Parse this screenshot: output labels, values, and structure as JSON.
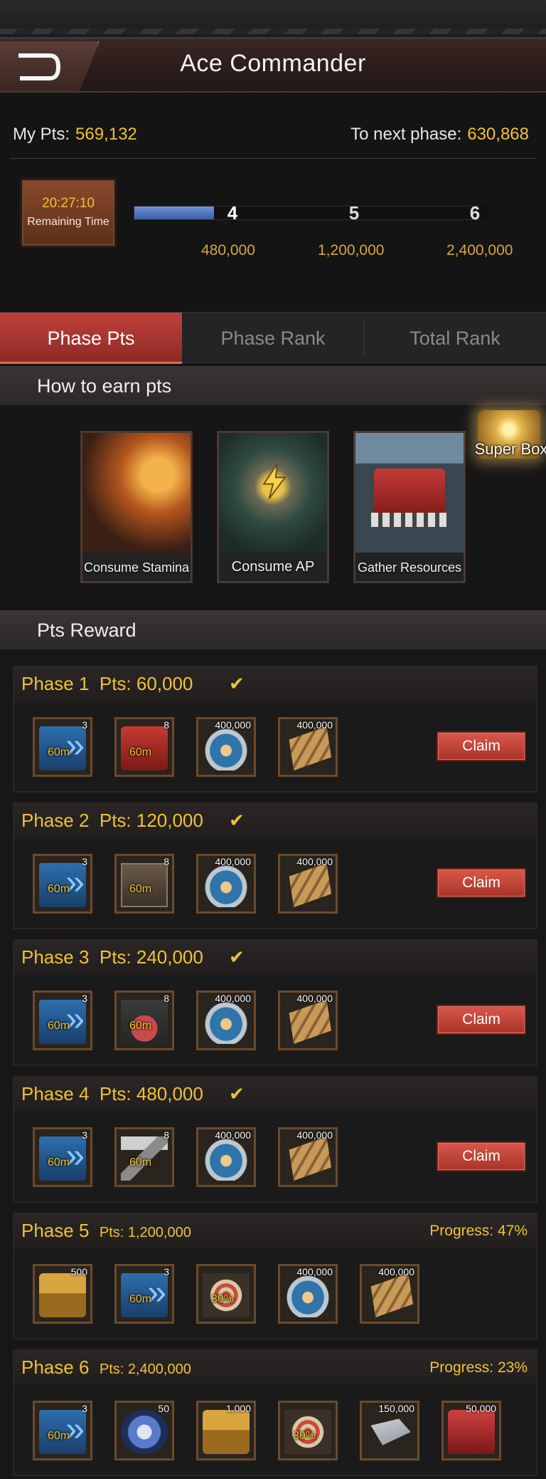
{
  "header": {
    "title": "Ace Commander"
  },
  "stats": {
    "my_pts_label": "My Pts:",
    "my_pts_value": "569,132",
    "next_phase_label": "To next phase:",
    "next_phase_value": "630,868"
  },
  "timer": {
    "time": "20:27:10",
    "label": "Remaining Time"
  },
  "phase_track": {
    "progress_fraction": 0.23,
    "nodes": [
      {
        "num": "4",
        "value": "480,000"
      },
      {
        "num": "5",
        "value": "1,200,000"
      },
      {
        "num": "6",
        "value": "2,400,000"
      }
    ]
  },
  "tabs": [
    "Phase Pts",
    "Phase Rank",
    "Total Rank"
  ],
  "earn": {
    "heading": "How to earn pts",
    "cards": [
      "Consume Stamina",
      "Consume AP",
      "Gather Resources"
    ],
    "super_box": "Super Box"
  },
  "rewards": {
    "heading": "Pts Reward",
    "claim_label": "Claim",
    "phases": [
      {
        "phase": "Phase 1",
        "pts": "Pts: 60,000",
        "checked": "✔",
        "items": [
          {
            "icon": "speedup-icon",
            "qty": "3",
            "tag": "60m"
          },
          {
            "icon": "toolbox-speedup-icon",
            "qty": "8",
            "tag": "60m"
          },
          {
            "icon": "food-can-icon",
            "qty": "400,000",
            "tag": ""
          },
          {
            "icon": "wood-icon",
            "qty": "400,000",
            "tag": ""
          }
        ]
      },
      {
        "phase": "Phase 2",
        "pts": "Pts: 120,000",
        "checked": "✔",
        "items": [
          {
            "icon": "speedup-icon",
            "qty": "3",
            "tag": "60m"
          },
          {
            "icon": "book-speedup-icon",
            "qty": "8",
            "tag": "60m"
          },
          {
            "icon": "food-can-icon",
            "qty": "400,000",
            "tag": ""
          },
          {
            "icon": "wood-icon",
            "qty": "400,000",
            "tag": ""
          }
        ]
      },
      {
        "phase": "Phase 3",
        "pts": "Pts: 240,000",
        "checked": "✔",
        "items": [
          {
            "icon": "speedup-icon",
            "qty": "3",
            "tag": "60m"
          },
          {
            "icon": "flask-speedup-icon",
            "qty": "8",
            "tag": "60m"
          },
          {
            "icon": "food-can-icon",
            "qty": "400,000",
            "tag": ""
          },
          {
            "icon": "wood-icon",
            "qty": "400,000",
            "tag": ""
          }
        ]
      },
      {
        "phase": "Phase 4",
        "pts": "Pts: 480,000",
        "checked": "✔",
        "items": [
          {
            "icon": "speedup-icon",
            "qty": "3",
            "tag": "60m"
          },
          {
            "icon": "hammer-speedup-icon",
            "qty": "8",
            "tag": "60m"
          },
          {
            "icon": "food-can-icon",
            "qty": "400,000",
            "tag": ""
          },
          {
            "icon": "wood-icon",
            "qty": "400,000",
            "tag": ""
          }
        ]
      },
      {
        "phase": "Phase 5",
        "pts": "Pts: 1,200,000",
        "progress": "Progress: 47%",
        "items": [
          {
            "icon": "chest-icon",
            "qty": "500",
            "tag": ""
          },
          {
            "icon": "speedup-icon",
            "qty": "3",
            "tag": "60m"
          },
          {
            "icon": "target-boost-icon",
            "qty": "",
            "tag": "30%"
          },
          {
            "icon": "food-can-icon",
            "qty": "400,000",
            "tag": ""
          },
          {
            "icon": "wood-icon",
            "qty": "400,000",
            "tag": ""
          }
        ]
      },
      {
        "phase": "Phase 6",
        "pts": "Pts: 2,400,000",
        "progress": "Progress: 23%",
        "items": [
          {
            "icon": "speedup-icon",
            "qty": "3",
            "tag": "60m"
          },
          {
            "icon": "turbine-icon",
            "qty": "50",
            "tag": ""
          },
          {
            "icon": "chest-icon",
            "qty": "1,000",
            "tag": ""
          },
          {
            "icon": "target-boost-icon",
            "qty": "",
            "tag": "30%"
          },
          {
            "icon": "steel-icon",
            "qty": "150,000",
            "tag": ""
          },
          {
            "icon": "fuel-can-icon",
            "qty": "50,000",
            "tag": ""
          }
        ]
      }
    ]
  }
}
